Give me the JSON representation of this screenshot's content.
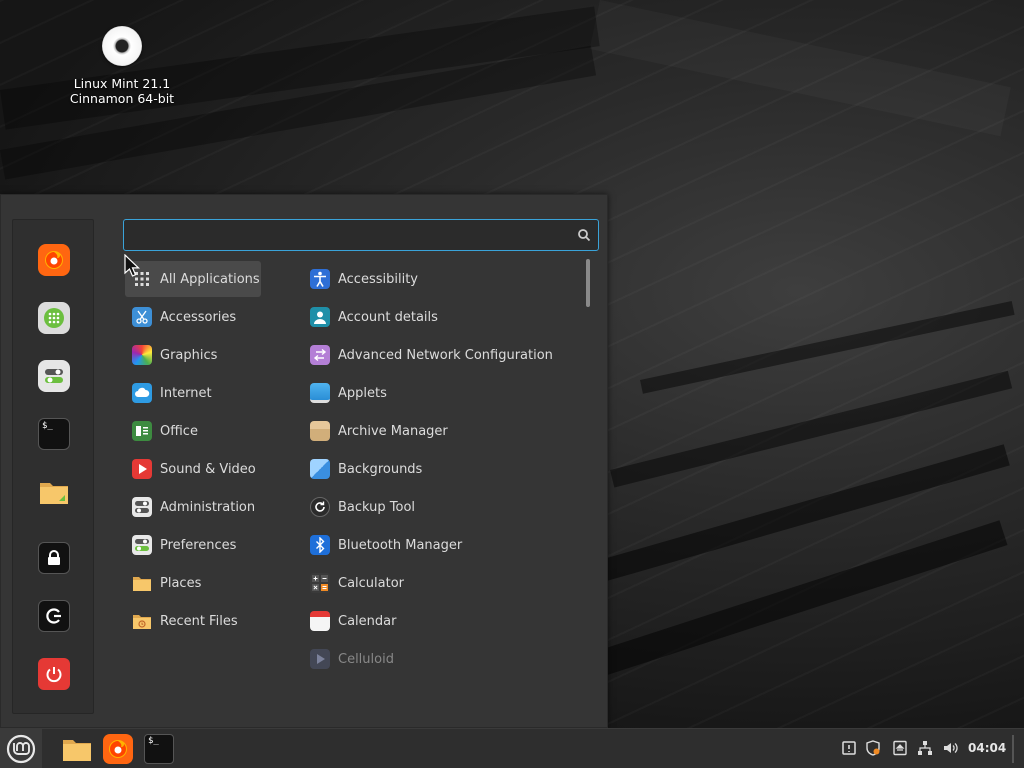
{
  "desktop": {
    "icon_label_line1": "Linux Mint 21.1",
    "icon_label_line2": "Cinnamon 64-bit",
    "icon": "optical-disc-icon"
  },
  "menu": {
    "search": {
      "value": "",
      "placeholder": ""
    },
    "favorites": [
      {
        "name": "firefox",
        "icon": "firefox-icon"
      },
      {
        "name": "software-manager",
        "icon": "software-manager-icon"
      },
      {
        "name": "system-settings",
        "icon": "settings-toggles-icon"
      },
      {
        "name": "terminal",
        "icon": "terminal-icon",
        "label": "$_"
      },
      {
        "name": "files",
        "icon": "folder-icon"
      },
      {
        "name": "lock-screen",
        "icon": "lock-icon"
      },
      {
        "name": "logout",
        "icon": "logout-icon"
      },
      {
        "name": "shutdown",
        "icon": "power-icon"
      }
    ],
    "categories": [
      {
        "label": "All Applications",
        "icon": "grid-icon",
        "selected": true
      },
      {
        "label": "Accessories",
        "icon": "scissors-icon"
      },
      {
        "label": "Graphics",
        "icon": "color-palette-icon"
      },
      {
        "label": "Internet",
        "icon": "cloud-icon"
      },
      {
        "label": "Office",
        "icon": "office-icon"
      },
      {
        "label": "Sound & Video",
        "icon": "play-icon"
      },
      {
        "label": "Administration",
        "icon": "admin-toggles-icon"
      },
      {
        "label": "Preferences",
        "icon": "preferences-toggles-icon"
      },
      {
        "label": "Places",
        "icon": "folder-icon"
      },
      {
        "label": "Recent Files",
        "icon": "recent-folder-icon"
      }
    ],
    "apps": [
      {
        "label": "Accessibility",
        "icon": "accessibility-icon"
      },
      {
        "label": "Account details",
        "icon": "user-icon"
      },
      {
        "label": "Advanced Network Configuration",
        "icon": "network-arrows-icon"
      },
      {
        "label": "Applets",
        "icon": "applets-icon"
      },
      {
        "label": "Archive Manager",
        "icon": "archive-box-icon"
      },
      {
        "label": "Backgrounds",
        "icon": "backgrounds-icon"
      },
      {
        "label": "Backup Tool",
        "icon": "backup-icon"
      },
      {
        "label": "Bluetooth Manager",
        "icon": "bluetooth-icon"
      },
      {
        "label": "Calculator",
        "icon": "calculator-icon"
      },
      {
        "label": "Calendar",
        "icon": "calendar-icon"
      },
      {
        "label": "Celluloid",
        "icon": "celluloid-icon",
        "dim": true
      }
    ]
  },
  "taskbar": {
    "menu_button_icon": "mint-logo-icon",
    "launchers": [
      {
        "name": "files",
        "icon": "folder-icon"
      },
      {
        "name": "firefox",
        "icon": "firefox-icon"
      },
      {
        "name": "terminal",
        "icon": "terminal-icon",
        "label": "$_"
      }
    ],
    "tray": [
      {
        "name": "notifications",
        "icon": "notification-icon"
      },
      {
        "name": "update-manager",
        "icon": "shield-icon"
      },
      {
        "name": "removable-drives",
        "icon": "drive-eject-icon"
      },
      {
        "name": "network",
        "icon": "network-icon"
      },
      {
        "name": "sound",
        "icon": "volume-icon"
      }
    ],
    "clock": "04:04"
  },
  "colors": {
    "accent": "#3aa3d9",
    "menu_bg": "#353535",
    "panel_bg": "#2e2e2e",
    "firefox": "#ff6611",
    "mint_green": "#8bc34a",
    "power_red": "#e53935"
  }
}
